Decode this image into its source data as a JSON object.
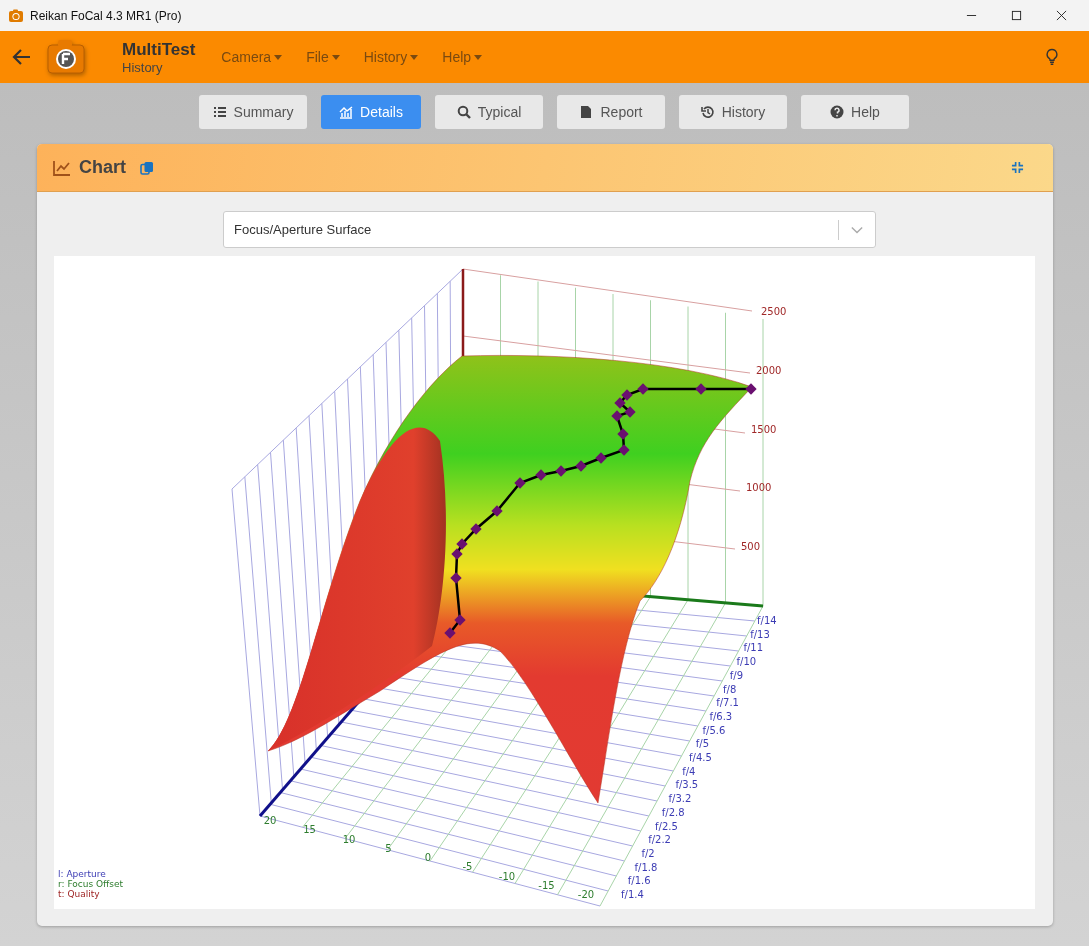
{
  "window": {
    "title": "Reikan FoCal 4.3 MR1 (Pro)"
  },
  "header": {
    "title": "MultiTest",
    "subtitle": "History",
    "menus": [
      "Camera",
      "File",
      "History",
      "Help"
    ]
  },
  "tabs": [
    {
      "label": "Summary",
      "selected": false
    },
    {
      "label": "Details",
      "selected": true
    },
    {
      "label": "Typical",
      "selected": false
    },
    {
      "label": "Report",
      "selected": false
    },
    {
      "label": "History",
      "selected": false
    },
    {
      "label": "Help",
      "selected": false
    }
  ],
  "panel": {
    "title": "Chart",
    "chart_select": {
      "value": "Focus/Aperture Surface"
    },
    "plot": {
      "quality_ticks": [
        "2500",
        "2000",
        "1500",
        "1000",
        "500"
      ],
      "aperture_ticks": [
        "f/14",
        "f/13",
        "f/11",
        "f/10",
        "f/9",
        "f/8",
        "f/7.1",
        "f/6.3",
        "f/5.6",
        "f/5",
        "f/4.5",
        "f/4",
        "f/3.5",
        "f/3.2",
        "f/2.8",
        "f/2.5",
        "f/2.2",
        "f/2",
        "f/1.8",
        "f/1.6",
        "f/1.4"
      ],
      "focus_ticks": [
        "20",
        "15",
        "10",
        "5",
        "0",
        "-5",
        "-10",
        "-15",
        "-20"
      ],
      "legend": [
        "l: Aperture",
        "r: Focus Offset",
        "t: Quality"
      ]
    }
  }
}
